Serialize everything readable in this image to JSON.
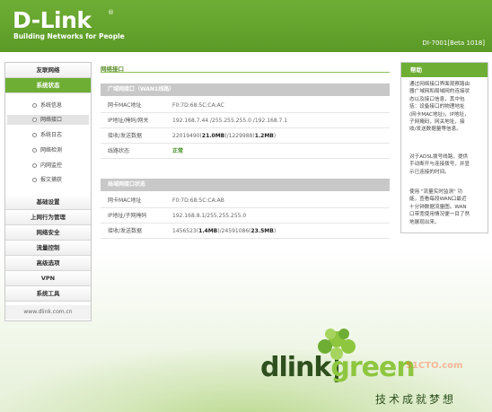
{
  "header": {
    "logo": "D-Link",
    "registered": "®",
    "tagline": "Building Networks for People",
    "model": "DI-7001[Beta 1018]"
  },
  "sidebar": {
    "top_item": "友联网络",
    "status_item": "系统状态",
    "sub_items": [
      "系统信息",
      "网络接口",
      "系统日志",
      "网络检测",
      "内网监控",
      "报文捕获"
    ],
    "active_sub": 1,
    "items": [
      "基础设置",
      "上网行为管理",
      "网络安全",
      "流量控制",
      "高级选项",
      "VPN",
      "系统工具"
    ],
    "footer": "www.dlink.com.cn"
  },
  "main": {
    "title": "网络接口",
    "wan": {
      "heading": "广域网接口（WAN1线路）",
      "rows": [
        {
          "label": "网卡MAC地址",
          "value": "F0:7D:68:5C:CA:AC"
        },
        {
          "label": "IP地址/掩码/网关",
          "value": "192.168.7.44 /255.255.255.0 /192.168.7.1"
        },
        {
          "label": "接收/发送数据",
          "v1": "22019490(",
          "b1": "21.0MB",
          "v2": ")/1229988(",
          "b2": "1.2MB",
          "v3": ")"
        },
        {
          "label": "线路状态",
          "value": "正常"
        }
      ]
    },
    "lan": {
      "heading": "局域网接口状态",
      "rows": [
        {
          "label": "网卡MAC地址",
          "value": "F0:7D:68:5C:CA:AB"
        },
        {
          "label": "IP地址/子网掩码",
          "value": "192.168.8.1/255.255.255.0"
        },
        {
          "label": "接收/发送数据",
          "v1": "1456523(",
          "b1": "1.4MB",
          "v2": ")/24591086(",
          "b2": "23.5MB",
          "v3": ")"
        }
      ]
    }
  },
  "help": {
    "title": "帮助",
    "p1": [
      "通过网络接口界面观察路由",
      "器广域网和局域网的连接状",
      "态以及接口信息，其中包",
      "括：设备接口的物理地址",
      "(网卡MAC地址)，IP地址，",
      "子网掩码，网关地址，接",
      "收/发送数据量等信息。"
    ],
    "p2": [
      "对于ADSL拨号线路，提供",
      "手动断开与连接拨号，并显",
      "示已连接的时间。"
    ],
    "p3": [
      "使用 \"流量实时监测\" 功",
      "能，查看每段WAN口最近",
      "十分钟数据流量图。WAN",
      "口带宽使用情况便一目了然",
      "地展现出来。"
    ]
  },
  "brand": {
    "d": "dlink",
    "g": "green",
    "watermark": "51CTO.com",
    "slogan": "技术成就梦想"
  },
  "colors": {
    "accent": "#6fae35",
    "header": "#5b9a26",
    "ok": "#3e8a1e"
  }
}
